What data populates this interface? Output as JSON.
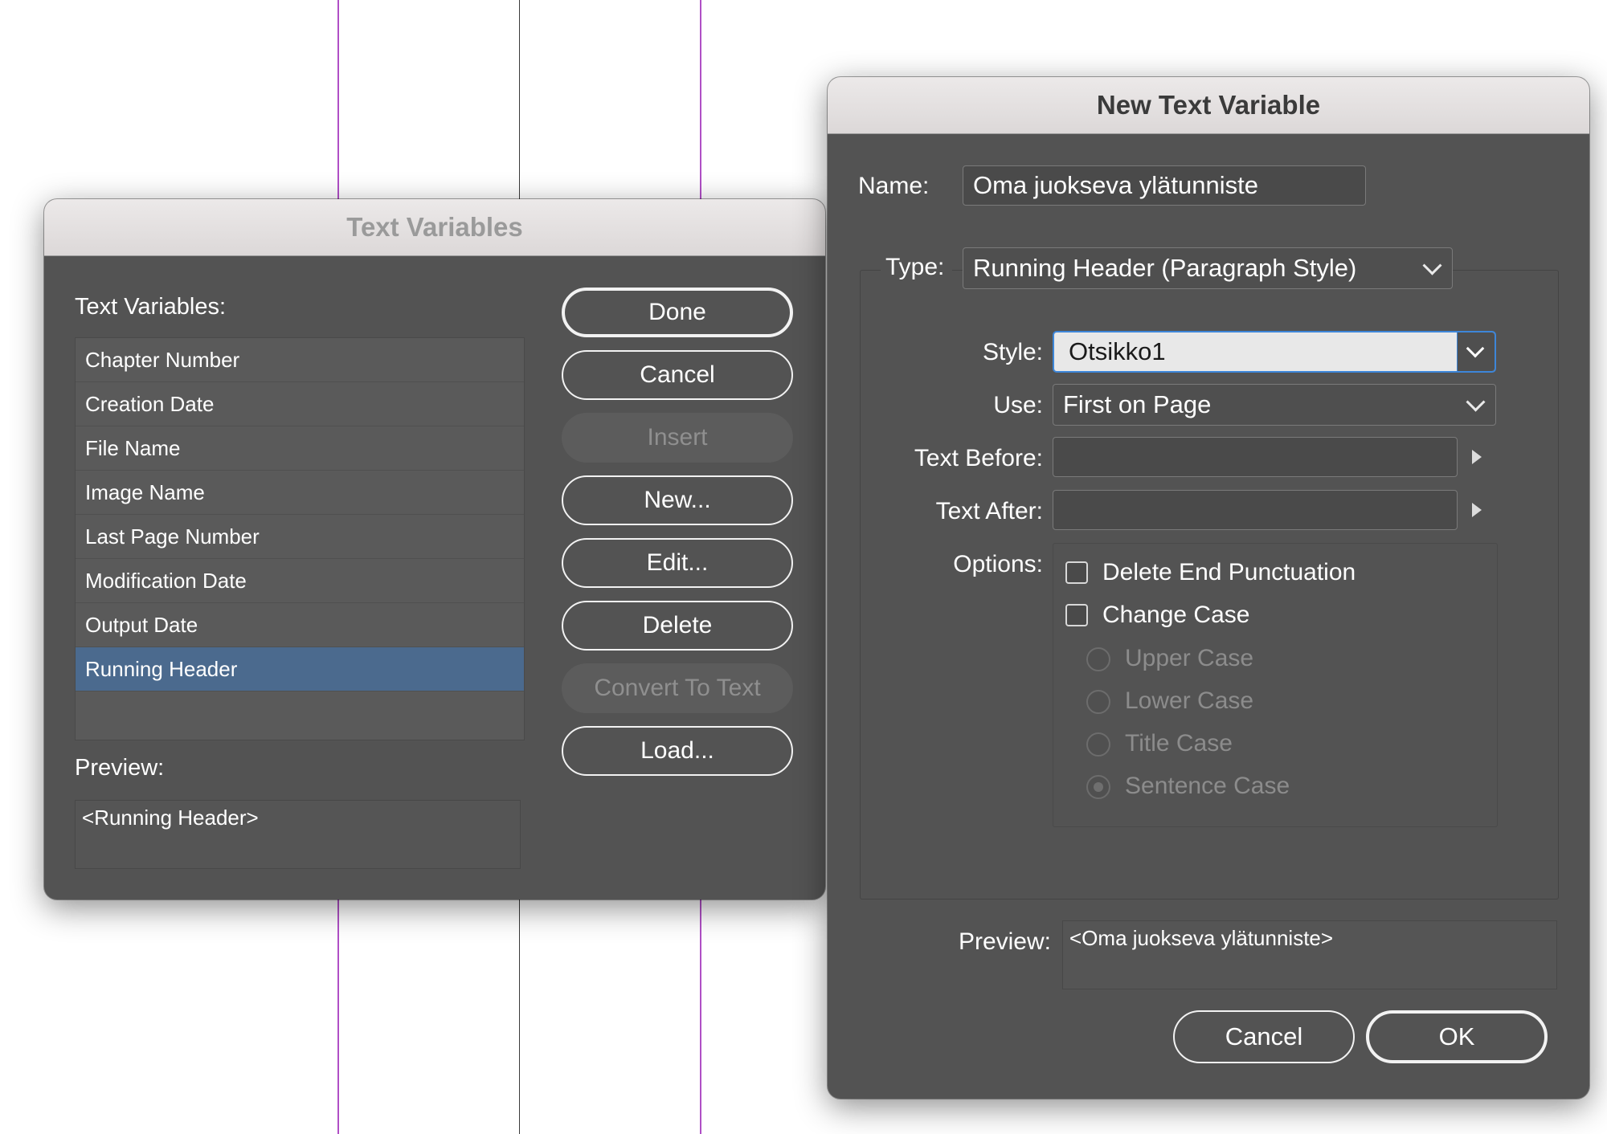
{
  "text_variables_dialog": {
    "title": "Text Variables",
    "list_label": "Text Variables:",
    "items": [
      {
        "label": "Chapter Number"
      },
      {
        "label": "Creation Date"
      },
      {
        "label": "File Name"
      },
      {
        "label": "Image Name"
      },
      {
        "label": "Last Page Number"
      },
      {
        "label": "Modification Date"
      },
      {
        "label": "Output Date"
      },
      {
        "label": "Running Header",
        "selected": true
      }
    ],
    "buttons": {
      "done": "Done",
      "cancel": "Cancel",
      "insert": "Insert",
      "new": "New...",
      "edit": "Edit...",
      "delete": "Delete",
      "convert": "Convert To Text",
      "load": "Load..."
    },
    "preview_label": "Preview:",
    "preview_text": "<Running Header>"
  },
  "new_text_variable_dialog": {
    "title": "New Text Variable",
    "name_label": "Name:",
    "name_value": "Oma juokseva ylätunniste",
    "type_label": "Type:",
    "type_value": "Running Header (Paragraph Style)",
    "style_label": "Style:",
    "style_value": "Otsikko1",
    "use_label": "Use:",
    "use_value": "First on Page",
    "text_before_label": "Text Before:",
    "text_before_value": "",
    "text_after_label": "Text After:",
    "text_after_value": "",
    "options_label": "Options:",
    "options": {
      "delete_end_punctuation": "Delete End Punctuation",
      "change_case": "Change Case",
      "upper_case": "Upper Case",
      "lower_case": "Lower Case",
      "title_case": "Title Case",
      "sentence_case": "Sentence Case"
    },
    "preview_label": "Preview:",
    "preview_text": "<Oma juokseva ylätunniste>",
    "cancel_label": "Cancel",
    "ok_label": "OK"
  },
  "colors": {
    "dialog_bg": "#535353",
    "selection": "#4b6a8e",
    "focus_ring": "#3d86d9",
    "guide_purple": "#b04fc6"
  }
}
